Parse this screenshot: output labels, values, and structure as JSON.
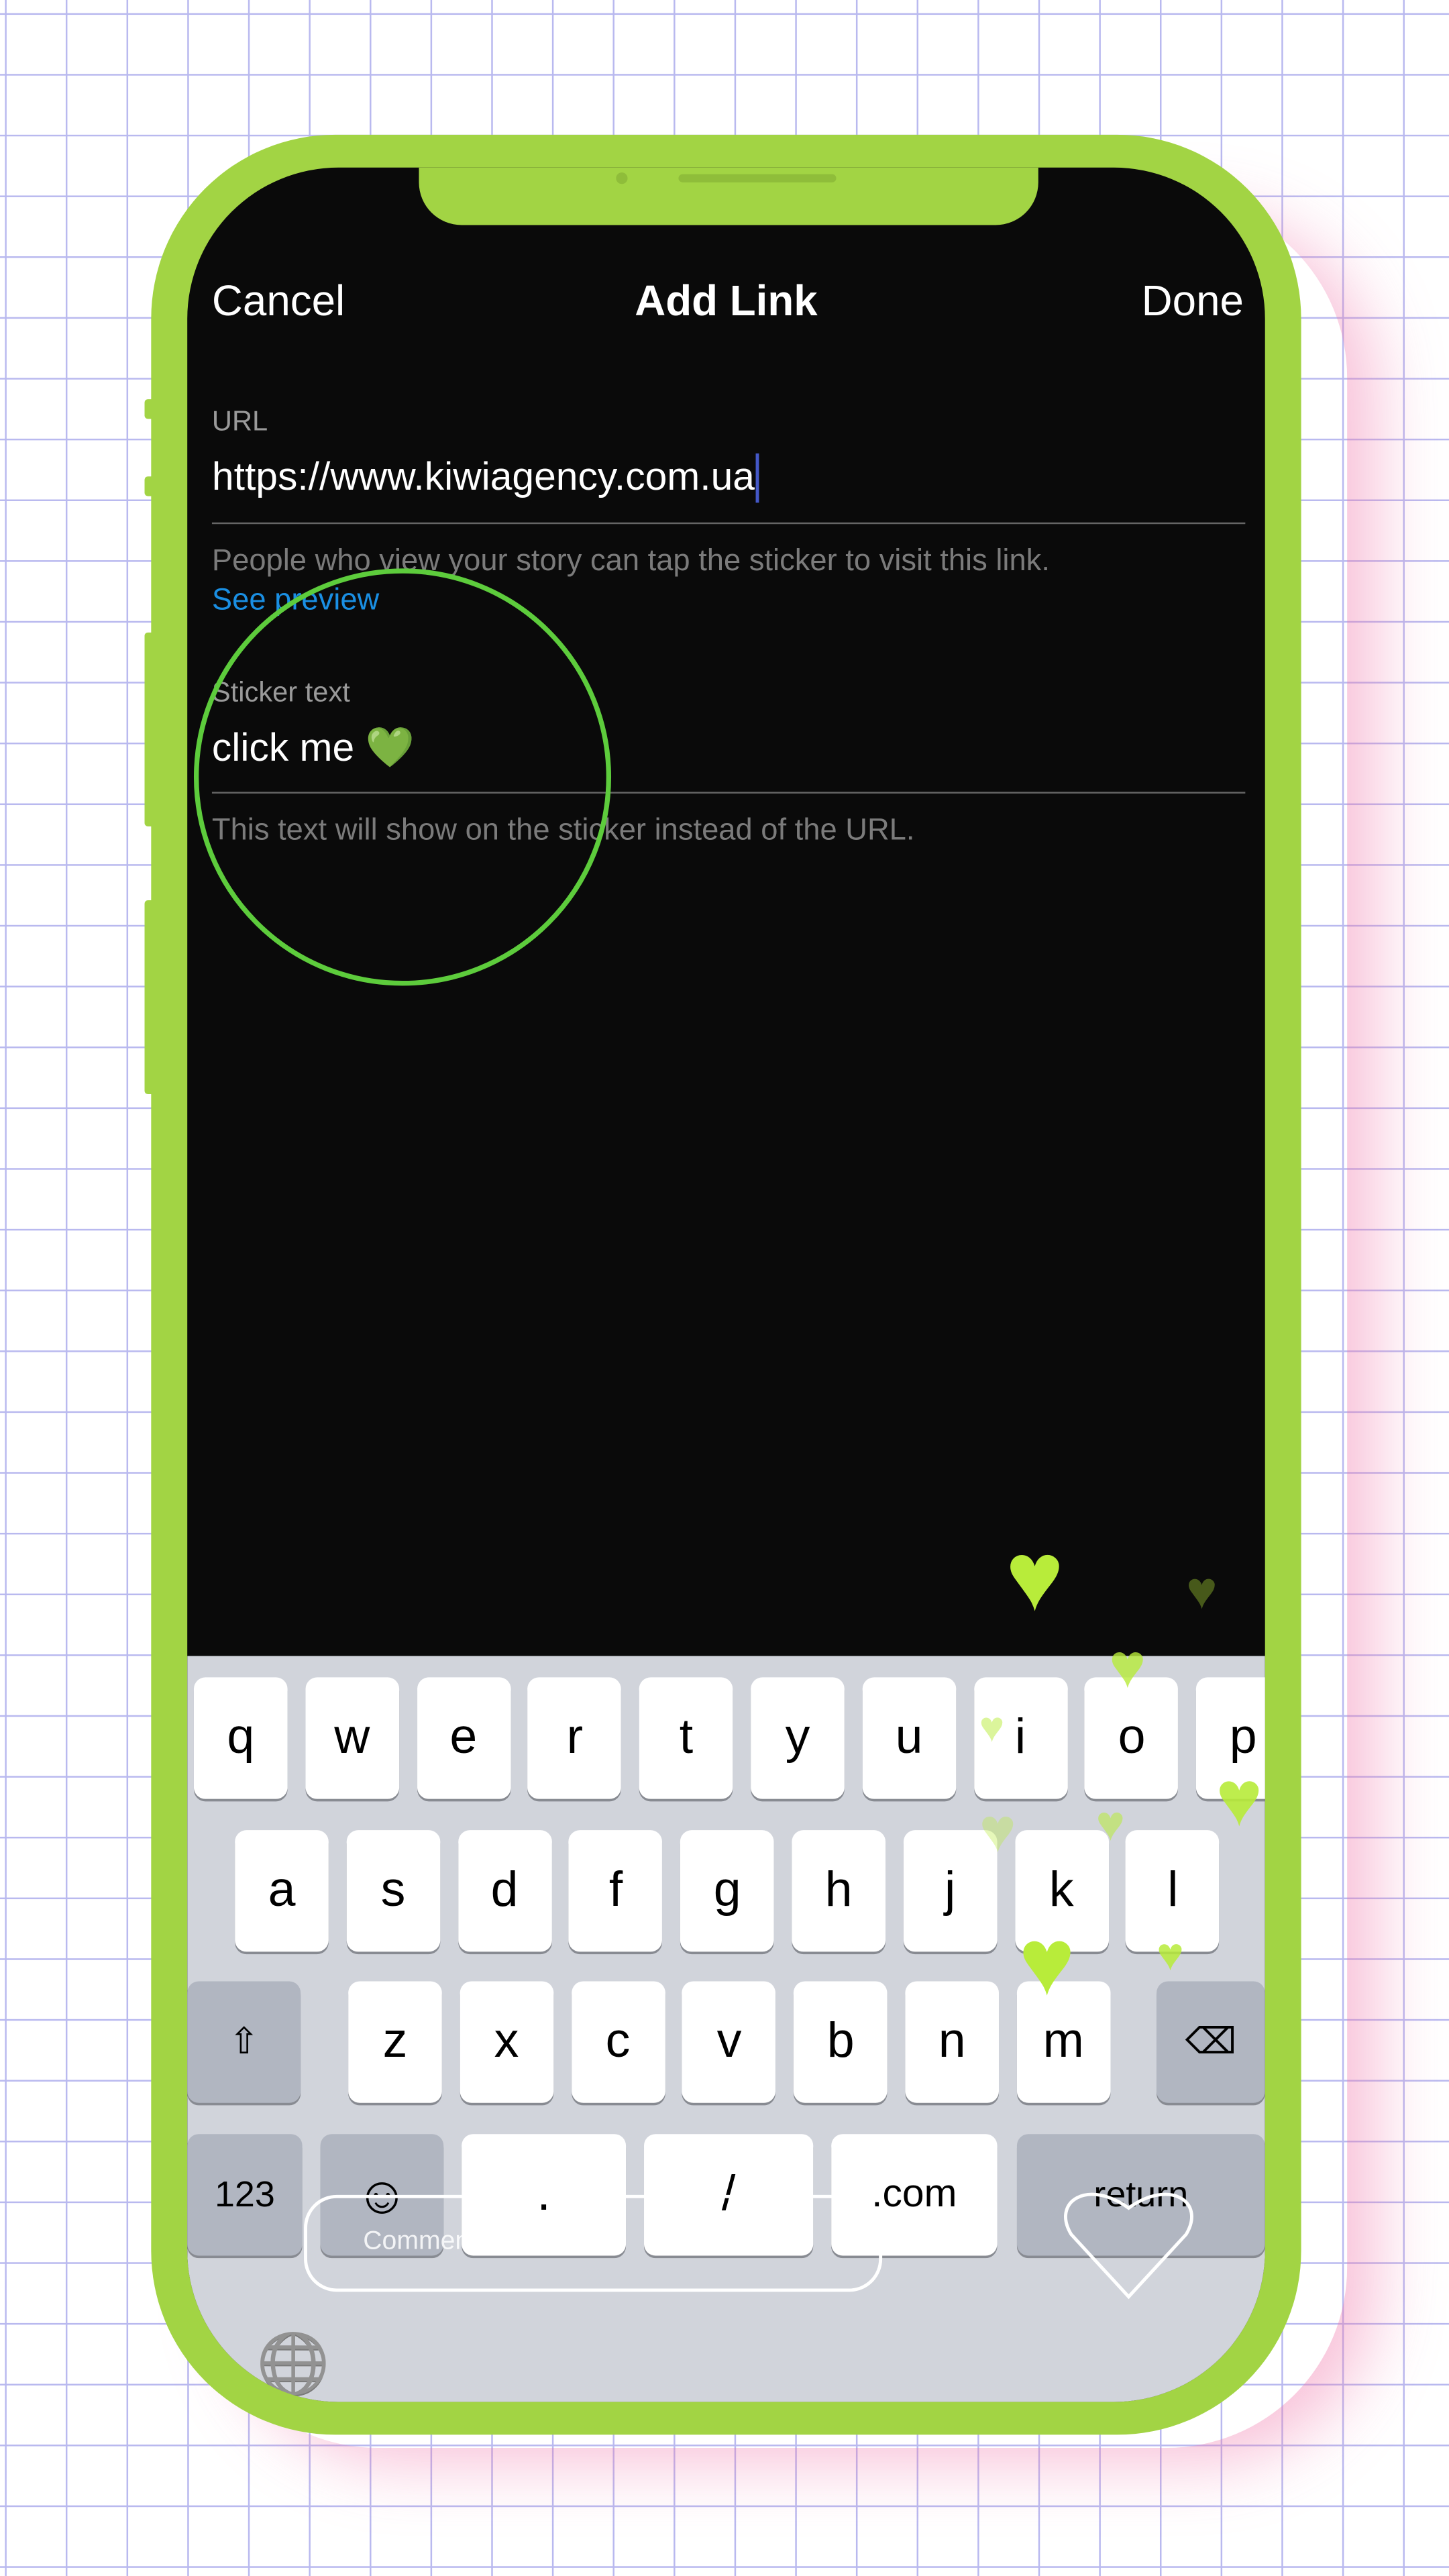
{
  "header": {
    "cancel": "Cancel",
    "title": "Add Link",
    "done": "Done"
  },
  "url": {
    "label": "URL",
    "value": "https://www.kiwiagency.com.ua",
    "hint": "People who view your story can tap the sticker to visit this link.",
    "preview_link": "See preview"
  },
  "sticker": {
    "label": "Sticker text",
    "value": "click me 💚",
    "hint": "This text will show on the sticker instead of the URL."
  },
  "keyboard": {
    "row1": [
      "q",
      "w",
      "e",
      "r",
      "t",
      "y",
      "u",
      "i",
      "o",
      "p"
    ],
    "row2": [
      "a",
      "s",
      "d",
      "f",
      "g",
      "h",
      "j",
      "k",
      "l"
    ],
    "row3": [
      "z",
      "x",
      "c",
      "v",
      "b",
      "n",
      "m"
    ],
    "shift": "⇧",
    "delete": "⌫",
    "numbers": "123",
    "emoji": "☺",
    "dot": ".",
    "slash": "/",
    "dotcom": ".com",
    "return": "return",
    "globe": "🌐"
  },
  "overlay": {
    "comment_placeholder": "Comments",
    "heart_glyph": "♥"
  },
  "colors": {
    "frame": "#a2d444",
    "link": "#1a8fe3",
    "highlight_circle": "#5dcc3c",
    "hearts": "#b8ec3a"
  }
}
